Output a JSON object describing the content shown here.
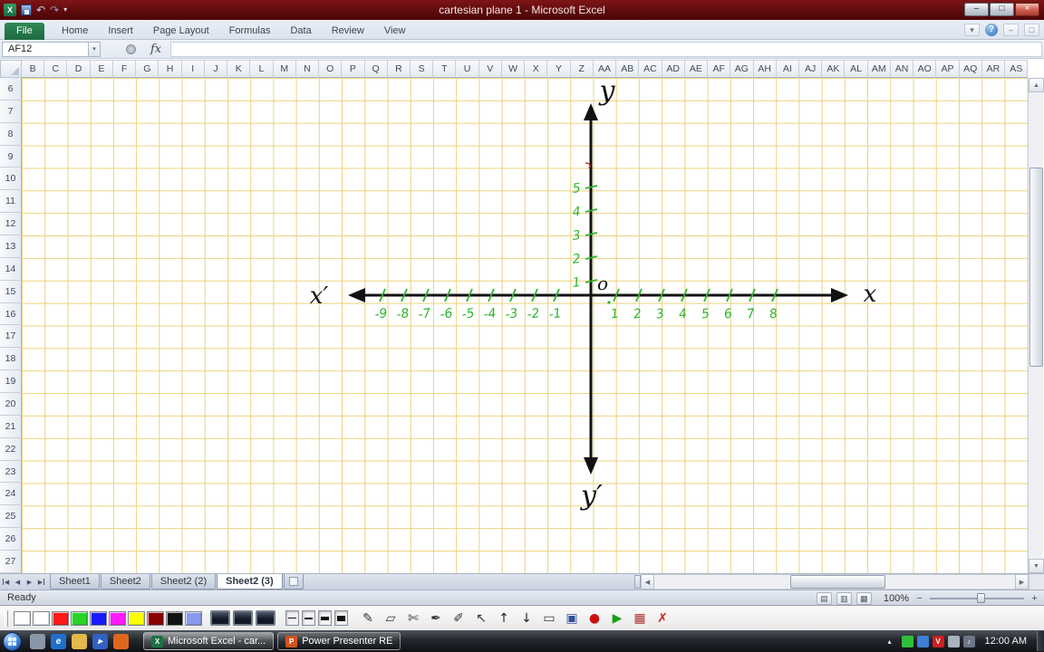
{
  "titlebar": {
    "title": "cartesian plane 1 - Microsoft Excel",
    "quick_access": {
      "excel_logo": "X",
      "undo_glyph": "↶",
      "redo_glyph": "↷",
      "dropdown_glyph": "▾"
    },
    "window_buttons": {
      "minimize": "–",
      "maximize": "□",
      "close": "×"
    }
  },
  "ribbon": {
    "file_tab": "File",
    "tabs": [
      "Home",
      "Insert",
      "Page Layout",
      "Formulas",
      "Data",
      "Review",
      "View"
    ],
    "right": {
      "collapse_glyph": "▾",
      "help_glyph": "?",
      "min_glyph": "–",
      "restore_glyph": "□"
    }
  },
  "formula_bar": {
    "name_box": "AF12",
    "dropdown_glyph": "▾",
    "fx": "fx"
  },
  "grid": {
    "columns": [
      "B",
      "C",
      "D",
      "E",
      "F",
      "G",
      "H",
      "I",
      "J",
      "K",
      "L",
      "M",
      "N",
      "O",
      "P",
      "Q",
      "R",
      "S",
      "T",
      "U",
      "V",
      "W",
      "X",
      "Y",
      "Z",
      "AA",
      "AB",
      "AC",
      "AD",
      "AE",
      "AF",
      "AG",
      "AH",
      "AI",
      "AJ",
      "AK",
      "AL",
      "AM",
      "AN",
      "AO",
      "AP",
      "AQ",
      "AR",
      "AS"
    ],
    "rows": [
      "6",
      "7",
      "8",
      "9",
      "10",
      "11",
      "12",
      "13",
      "14",
      "15",
      "16",
      "17",
      "18",
      "19",
      "20",
      "21",
      "22",
      "23",
      "24",
      "25",
      "26",
      "27"
    ]
  },
  "drawing": {
    "y_label": "y",
    "y_prime_label": "y′",
    "x_label": "x",
    "x_prime_label": "x′",
    "origin_label": "o",
    "y_axis_numbers": [
      "5",
      "4",
      "3",
      "2",
      "1"
    ],
    "x_axis_negative": [
      "-9",
      "-8",
      "-7",
      "-6",
      "-5",
      "-4",
      "-3",
      "-2",
      "-1"
    ],
    "x_axis_positive": [
      "1",
      "2",
      "3",
      "4",
      "5",
      "6",
      "7",
      "8"
    ],
    "ink_color": "#2eb52e",
    "axis_color": "#111111",
    "mark_color": "#cc3333"
  },
  "sheet_tabs": {
    "nav": {
      "first": "◀",
      "prev": "◀",
      "next": "▶",
      "last": "▶"
    },
    "tabs": [
      {
        "label": "Sheet1",
        "active": false
      },
      {
        "label": "Sheet2",
        "active": false
      },
      {
        "label": "Sheet2 (2)",
        "active": false
      },
      {
        "label": "Sheet2 (3)",
        "active": true
      }
    ]
  },
  "scroll": {
    "up": "▲",
    "down": "▼",
    "left": "◀",
    "right": "▶"
  },
  "status_bar": {
    "mode": "Ready",
    "view_icons": [
      "▤",
      "▥",
      "▦"
    ],
    "zoom": "100%",
    "zoom_out": "−",
    "zoom_in": "+"
  },
  "annotation_toolbar": {
    "swatches": [
      "#ffffff",
      "#ffffff",
      "#ff1a1a",
      "#28d428",
      "#1a1aff",
      "#ff1aff",
      "#ffff00",
      "#8b0000",
      "#111111",
      "#8899ee"
    ],
    "screens": 3,
    "line_widths": [
      1,
      2,
      4,
      6
    ],
    "tools": [
      {
        "name": "pencil-all-tool",
        "glyph": "✎",
        "color": "#333333"
      },
      {
        "name": "eraser-tool",
        "glyph": "▱",
        "color": "#333333"
      },
      {
        "name": "cutter-tool",
        "glyph": "✄",
        "color": "#333333"
      },
      {
        "name": "pen-tool",
        "glyph": "✒",
        "color": "#333333"
      },
      {
        "name": "brush-tool",
        "glyph": "✐",
        "color": "#333333"
      },
      {
        "name": "pointer-tool",
        "glyph": "↖",
        "color": "#333333"
      },
      {
        "name": "arrow-up-tool",
        "glyph": "↑",
        "color": "#222222"
      },
      {
        "name": "arrow-down-tool",
        "glyph": "↓",
        "color": "#222222"
      },
      {
        "name": "whiteboard-tool",
        "glyph": "▭",
        "color": "#333333"
      },
      {
        "name": "save-tool",
        "glyph": "▣",
        "color": "#334d99"
      },
      {
        "name": "record-tool",
        "glyph": "●",
        "color": "#cc1111"
      },
      {
        "name": "play-tool",
        "glyph": "▶",
        "color": "#18a018"
      },
      {
        "name": "grid-tool",
        "glyph": "▦",
        "color": "#aa3333"
      },
      {
        "name": "exit-tool",
        "glyph": "✗",
        "color": "#cc2222"
      }
    ]
  },
  "taskbar": {
    "quick_launch": [
      {
        "name": "quick-launch-desktop-icon",
        "color": "#8a97a8",
        "glyph": ""
      },
      {
        "name": "quick-launch-ie-icon",
        "color": "#1f6fd0",
        "glyph": "e"
      },
      {
        "name": "quick-launch-folder-icon",
        "color": "#e3b84d",
        "glyph": ""
      },
      {
        "name": "quick-launch-media-icon",
        "color": "#2f62c4",
        "glyph": "▸"
      },
      {
        "name": "quick-launch-app-icon",
        "color": "#e0661e",
        "glyph": ""
      }
    ],
    "tasks": [
      {
        "label": "Microsoft Excel - car...",
        "icon_letter": "X",
        "icon_color": "#1e7145",
        "active": true
      },
      {
        "label": "Power Presenter RE",
        "icon_letter": "P",
        "icon_color": "#d2541e",
        "active": false
      }
    ],
    "hidden_icons_glyph": "▴",
    "tray_icons": [
      {
        "name": "tray-icon-green",
        "color": "#2fbf3a",
        "glyph": ""
      },
      {
        "name": "tray-icon-blue",
        "color": "#3f7fd6",
        "glyph": ""
      },
      {
        "name": "tray-icon-red-v",
        "color": "#cf1f1f",
        "glyph": "V"
      },
      {
        "name": "tray-icon-network",
        "color": "#aab2bd",
        "glyph": ""
      },
      {
        "name": "tray-icon-volume",
        "color": "#6b7686",
        "glyph": "♪"
      }
    ],
    "clock": "12:00 AM"
  }
}
